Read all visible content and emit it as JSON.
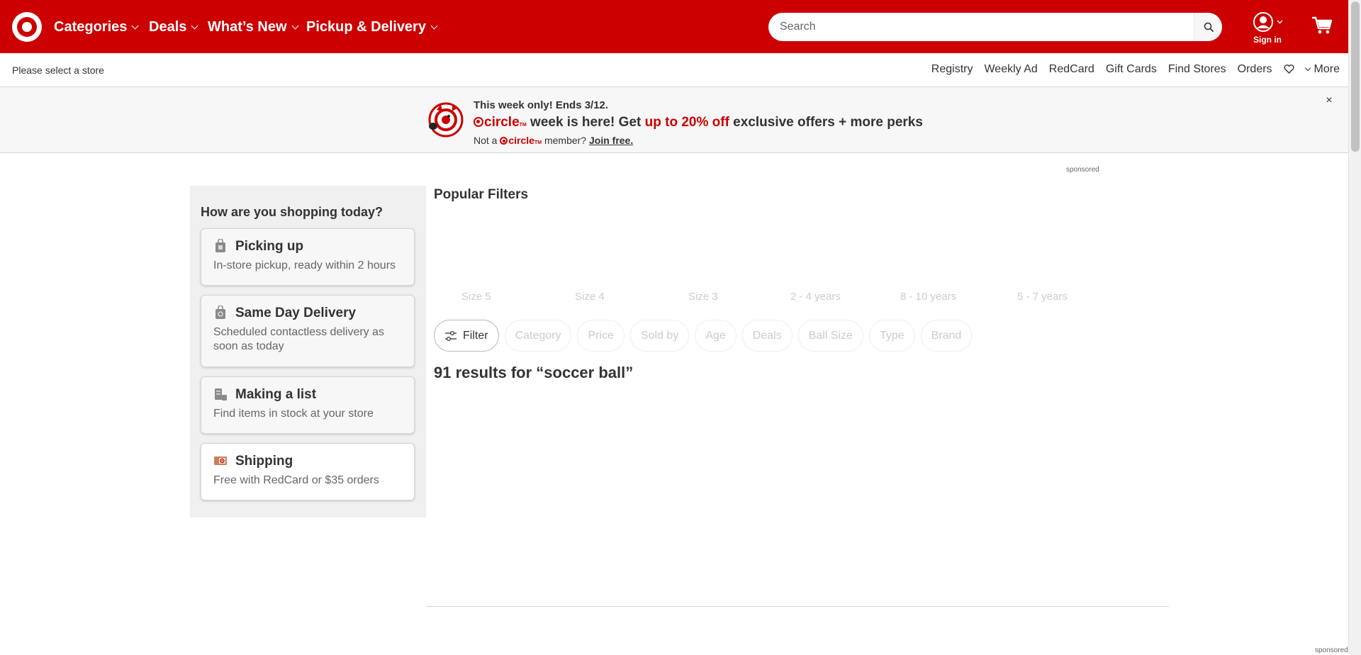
{
  "header": {
    "logo_icon": "target-bullseye-logo",
    "nav": [
      "Categories",
      "Deals",
      "What’s New",
      "Pickup & Delivery"
    ],
    "search": {
      "placeholder": "Search",
      "value": ""
    },
    "signin_label": "Sign in",
    "brand_color": "#cc0000"
  },
  "utility": {
    "store_select": "Please select a store",
    "links": [
      "Registry",
      "Weekly Ad",
      "RedCard",
      "Gift Cards",
      "Find Stores",
      "Orders"
    ],
    "more_label": "More"
  },
  "promo": {
    "line1": "This week only! Ends 3/12.",
    "brand_word": "circle",
    "line2_mid": " week is here! Get ",
    "line2_highlight": "up to 20% off",
    "line2_end": " exclusive offers + more perks",
    "line3_start": "Not a ",
    "line3_mid": " member? ",
    "join_label": "Join free.",
    "close_label": "×"
  },
  "sponsored_label": "sponsored",
  "shopping": {
    "heading": "How are you shopping today?",
    "options": [
      {
        "title": "Picking up",
        "desc": "In-store pickup, ready within 2 hours",
        "icon": "pickup-bag-icon"
      },
      {
        "title": "Same Day Delivery",
        "desc": "Scheduled contactless delivery as soon as today",
        "icon": "delivery-bag-icon"
      },
      {
        "title": "Making a list",
        "desc": "Find items in stock at your store",
        "icon": "list-icon"
      },
      {
        "title": "Shipping",
        "desc": "Free with RedCard or $35 orders",
        "icon": "shipping-box-icon"
      }
    ]
  },
  "popular_filters": {
    "title": "Popular Filters",
    "items": [
      "Size 5",
      "Size 4",
      "Size 3",
      "2 - 4 years",
      "8 - 10 years",
      "5 - 7 years"
    ]
  },
  "filter_chips": {
    "filter_label": "Filter",
    "chips": [
      "Category",
      "Price",
      "Sold by",
      "Age",
      "Deals",
      "Ball Size",
      "Type",
      "Brand"
    ]
  },
  "results": {
    "title": "91 results for “soccer ball”"
  }
}
